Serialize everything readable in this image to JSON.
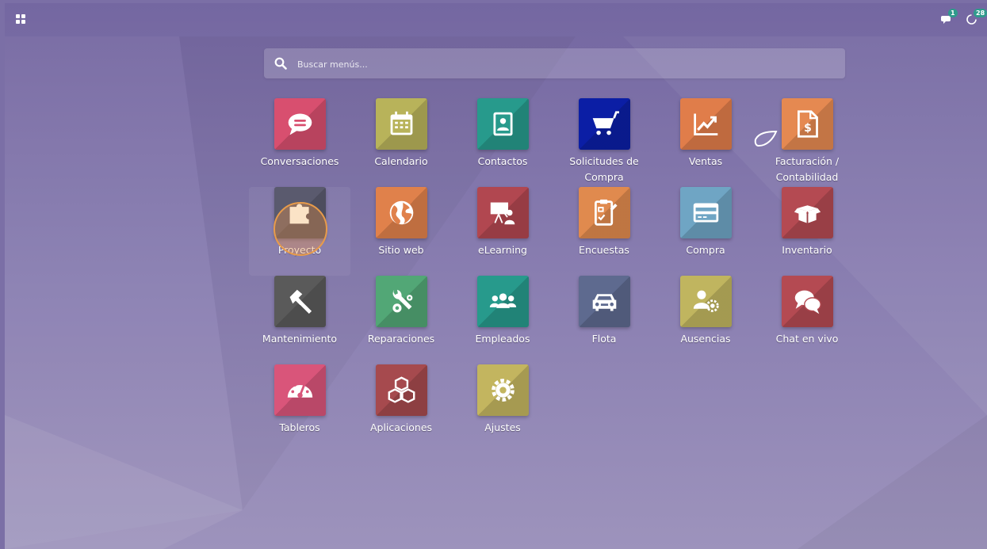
{
  "topbar": {
    "apps_icon": "apps-grid-icon",
    "messages_icon": "chat-bubbles-icon",
    "messages_count": "1",
    "activities_icon": "clock-icon",
    "activities_count": "28"
  },
  "search": {
    "icon": "search-icon",
    "placeholder": "Buscar menús..."
  },
  "apps": [
    {
      "label": "Conversaciones",
      "icon": "chat-bubble-icon",
      "color": "#d84f6f"
    },
    {
      "label": "Calendario",
      "icon": "calendar-icon",
      "color": "#b8b35a"
    },
    {
      "label": "Contactos",
      "icon": "address-book-icon",
      "color": "#279a8c"
    },
    {
      "label": "Solicitudes de Compra",
      "icon": "shopping-cart-icon",
      "color": "#0b1ea5"
    },
    {
      "label": "Ventas",
      "icon": "trend-chart-icon",
      "color": "#e07d4a"
    },
    {
      "label": "Facturación / Contabilidad",
      "icon": "invoice-dollar-icon",
      "color": "#e58951"
    },
    {
      "label": "Proyecto",
      "icon": "puzzle-icon",
      "color": "#5a5a6e"
    },
    {
      "label": "Sitio web",
      "icon": "globe-icon",
      "color": "#e0814b"
    },
    {
      "label": "eLearning",
      "icon": "presentation-icon",
      "color": "#b14750"
    },
    {
      "label": "Encuestas",
      "icon": "clipboard-check-icon",
      "color": "#e08a4e"
    },
    {
      "label": "Compra",
      "icon": "credit-card-icon",
      "color": "#6fa5c4"
    },
    {
      "label": "Inventario",
      "icon": "box-icon",
      "color": "#b44a52"
    },
    {
      "label": "Mantenimiento",
      "icon": "hammer-icon",
      "color": "#5a5a5a"
    },
    {
      "label": "Reparaciones",
      "icon": "wrench-gears-icon",
      "color": "#52a776"
    },
    {
      "label": "Empleados",
      "icon": "users-icon",
      "color": "#279a8c"
    },
    {
      "label": "Flota",
      "icon": "car-icon",
      "color": "#5e6a8f"
    },
    {
      "label": "Ausencias",
      "icon": "user-gear-icon",
      "color": "#c0b55f"
    },
    {
      "label": "Chat en vivo",
      "icon": "comments-icon",
      "color": "#b44a52"
    },
    {
      "label": "Tableros",
      "icon": "gauge-icon",
      "color": "#d9557a"
    },
    {
      "label": "Aplicaciones",
      "icon": "cubes-icon",
      "color": "#a64a4e"
    },
    {
      "label": "Ajustes",
      "icon": "gear-icon",
      "color": "#c3b55f"
    }
  ]
}
